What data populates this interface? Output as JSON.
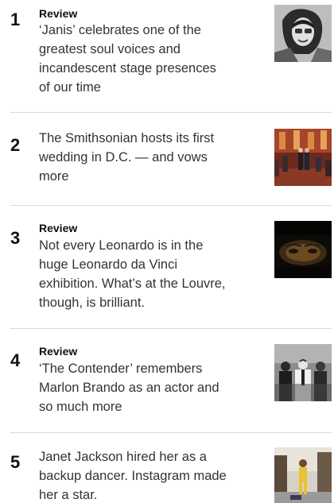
{
  "most_read": {
    "items": [
      {
        "rank": "1",
        "kicker": "Review",
        "headline": "‘Janis’ celebrates one of the greatest soul voices and incandescent stage presences of our time",
        "thumbnail_icon": "janis-joplin-photo"
      },
      {
        "rank": "2",
        "kicker": "",
        "headline": "The Smithsonian hosts its first wedding in D.C. — and vows more",
        "thumbnail_icon": "wedding-ceremony-photo"
      },
      {
        "rank": "3",
        "kicker": "Review",
        "headline": "Not every Leonardo is in the huge Leonardo da Vinci exhibition. What’s at the Louvre, though, is brilliant.",
        "thumbnail_icon": "mona-lisa-detail-photo"
      },
      {
        "rank": "4",
        "kicker": "Review",
        "headline": "‘The Contender’ remembers Marlon Brando as an actor and so much more",
        "thumbnail_icon": "marlon-brando-crowd-photo"
      },
      {
        "rank": "5",
        "kicker": "",
        "headline": "Janet Jackson hired her as a backup dancer. Instagram made her a star.",
        "thumbnail_icon": "dancer-street-photo"
      }
    ]
  }
}
